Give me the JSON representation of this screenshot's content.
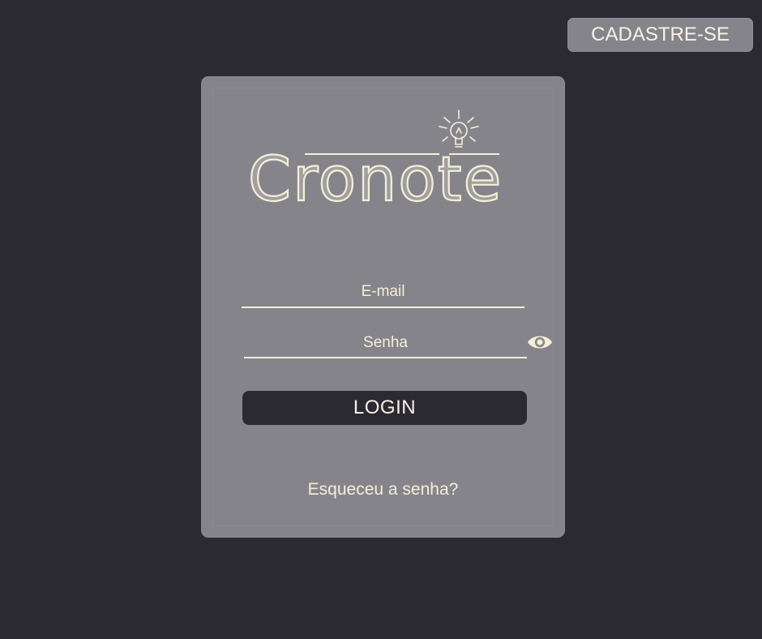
{
  "header": {
    "signup_label": "CADASTRE-SE"
  },
  "login_card": {
    "logo_text": "Cronote",
    "email": {
      "placeholder": "E-mail",
      "value": ""
    },
    "password": {
      "placeholder": "Senha",
      "value": ""
    },
    "show_password_icon": "eye-icon",
    "login_label": "LOGIN",
    "forgot_password_label": "Esqueceu a senha?"
  },
  "colors": {
    "background": "#2b2a33",
    "card": "#86848b",
    "text": "#f3f0d8"
  }
}
